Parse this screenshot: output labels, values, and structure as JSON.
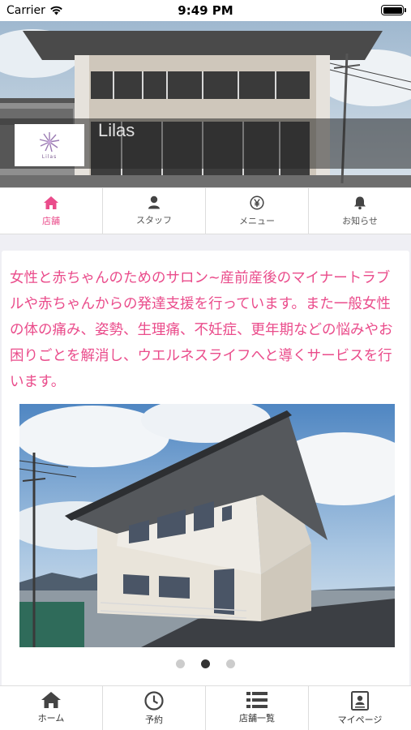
{
  "status_bar": {
    "carrier": "Carrier",
    "time": "9:49 PM"
  },
  "header": {
    "shop_name": "Lilas",
    "logo_text": "Lilas"
  },
  "tabs": [
    {
      "label": "店舗",
      "icon": "home-icon",
      "active": true
    },
    {
      "label": "スタッフ",
      "icon": "person-icon",
      "active": false
    },
    {
      "label": "メニュー",
      "icon": "yen-icon",
      "active": false
    },
    {
      "label": "お知らせ",
      "icon": "bell-icon",
      "active": false
    }
  ],
  "description": "女性と赤ちゃんのためのサロン~産前産後のマイナートラブルや赤ちゃんからの発達支援を行っています。また一般女性の体の痛み、姿勢、生理痛、不妊症、更年期などの悩みやお困りごとを解消し、ウエルネスライフへと導くサービスを行います。",
  "carousel": {
    "slide_count": 3,
    "active_index": 1
  },
  "bottom_nav": [
    {
      "label": "ホーム",
      "icon": "home-icon"
    },
    {
      "label": "予約",
      "icon": "clock-icon"
    },
    {
      "label": "店舗一覧",
      "icon": "list-icon"
    },
    {
      "label": "マイページ",
      "icon": "profile-card-icon"
    }
  ],
  "colors": {
    "accent": "#ea4c8b",
    "background": "#efeff4"
  }
}
